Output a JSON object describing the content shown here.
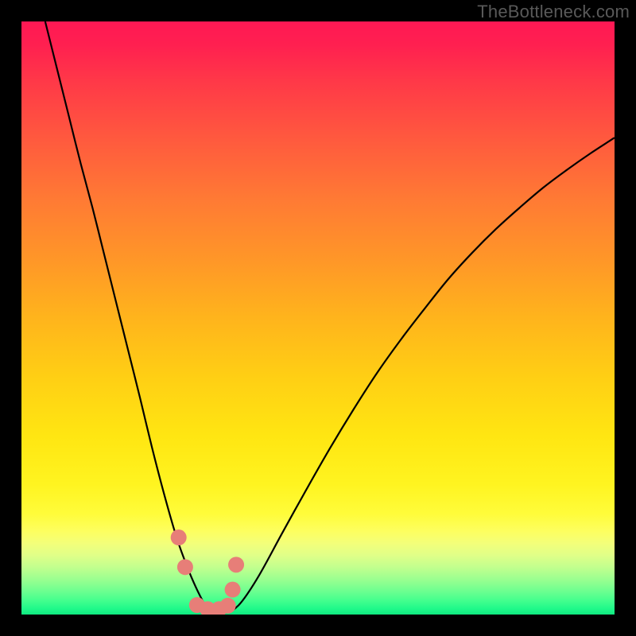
{
  "watermark": "TheBottleneck.com",
  "chart_data": {
    "type": "line",
    "title": "",
    "xlabel": "",
    "ylabel": "",
    "xlim": [
      0,
      100
    ],
    "ylim": [
      0,
      100
    ],
    "grid": false,
    "legend": false,
    "background": "red-to-green-vertical-gradient",
    "note": "Axis unit is percent of plot area; (0,0) is bottom-left. Curves depict bottleneck severity dropping to ~0 near x≈31 then rising again.",
    "series": [
      {
        "name": "left-curve",
        "type": "line",
        "color": "#000000",
        "x": [
          4.0,
          6.0,
          8.0,
          10.0,
          12.0,
          14.0,
          16.0,
          18.0,
          20.0,
          22.0,
          24.0,
          26.0,
          27.5,
          29.0,
          30.5,
          31.8
        ],
        "values": [
          100.0,
          92.0,
          84.0,
          76.0,
          68.5,
          60.5,
          52.5,
          44.5,
          36.5,
          28.2,
          20.5,
          13.5,
          9.2,
          5.5,
          2.4,
          0.3
        ]
      },
      {
        "name": "right-curve",
        "type": "line",
        "color": "#000000",
        "x": [
          35.0,
          37.0,
          40.0,
          44.0,
          48.0,
          52.0,
          56.0,
          60.0,
          64.0,
          68.0,
          72.0,
          76.0,
          80.0,
          84.0,
          88.0,
          92.0,
          96.0,
          100.0
        ],
        "values": [
          0.3,
          2.0,
          6.5,
          13.8,
          21.0,
          28.0,
          34.6,
          40.8,
          46.4,
          51.6,
          56.6,
          61.0,
          65.0,
          68.6,
          72.0,
          75.0,
          77.8,
          80.4
        ]
      },
      {
        "name": "markers",
        "type": "scatter",
        "color": "#e77e78",
        "radius": 10,
        "x": [
          26.5,
          27.6,
          29.6,
          31.4,
          33.3,
          34.8,
          35.6,
          36.2
        ],
        "values": [
          13.0,
          8.0,
          1.6,
          0.9,
          0.9,
          1.5,
          4.2,
          8.4
        ]
      }
    ]
  }
}
